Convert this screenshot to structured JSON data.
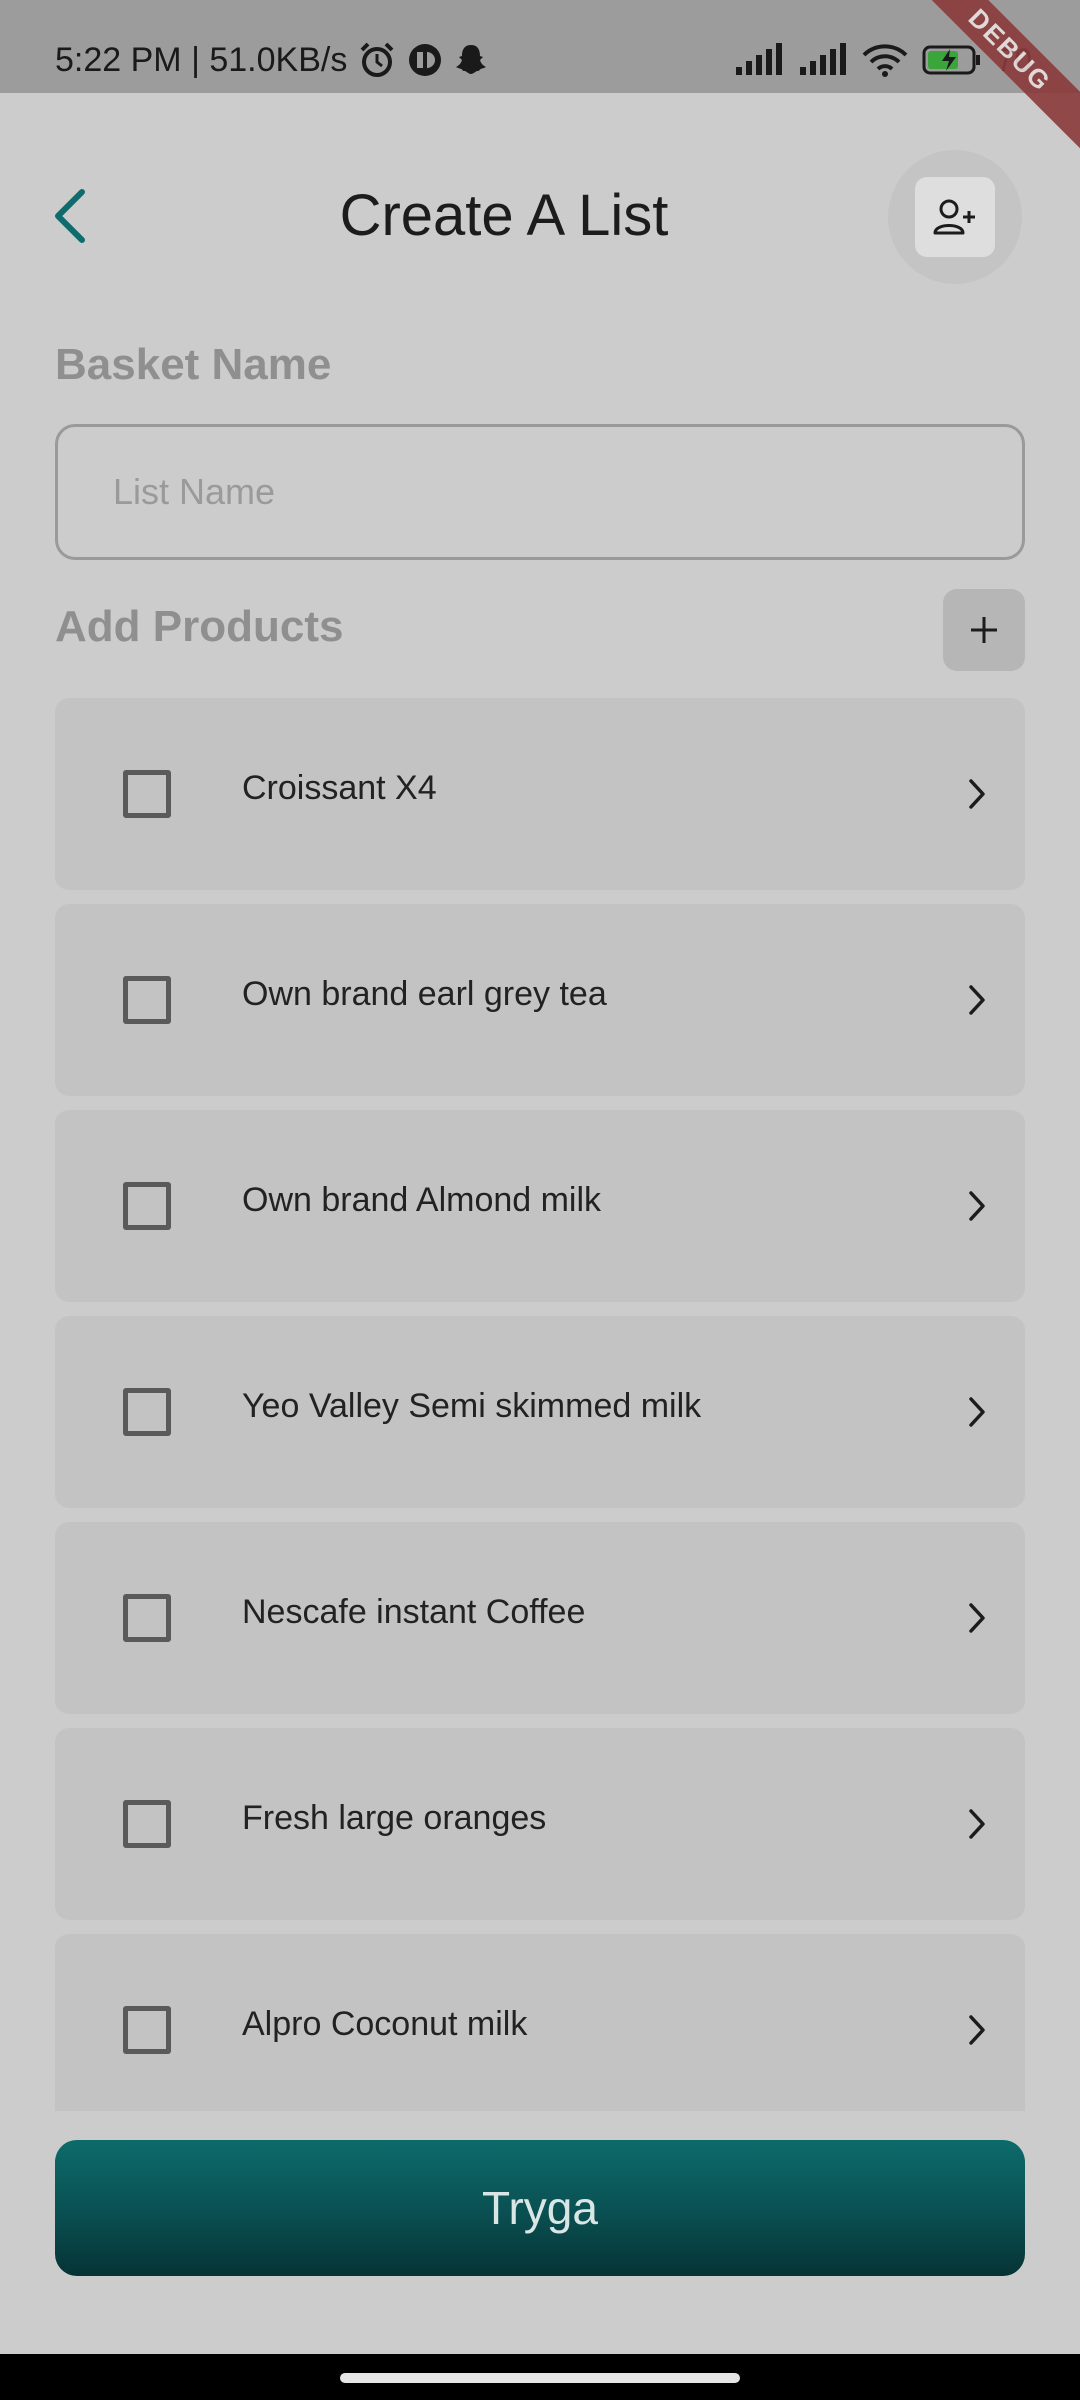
{
  "status_bar": {
    "time_speed": "5:22 PM | 51.0KB/s",
    "battery": "70"
  },
  "debug_banner": "DEBUG",
  "header": {
    "title": "Create A List"
  },
  "basket": {
    "label": "Basket Name",
    "input_placeholder": "List Name",
    "input_value": ""
  },
  "products": {
    "label": "Add Products",
    "items": [
      {
        "name": "Croissant X4",
        "checked": false
      },
      {
        "name": "Own brand earl grey tea",
        "checked": false
      },
      {
        "name": "Own brand Almond milk",
        "checked": false
      },
      {
        "name": "Yeo Valley Semi skimmed milk",
        "checked": false
      },
      {
        "name": "Nescafe instant Coffee",
        "checked": false
      },
      {
        "name": "Fresh large oranges",
        "checked": false
      },
      {
        "name": "Alpro Coconut milk",
        "checked": false
      }
    ]
  },
  "primary_button": {
    "label": "Tryga"
  },
  "colors": {
    "accent": "#0a5a5c",
    "back_icon": "#0e6b6e",
    "background": "#cccccc"
  },
  "icons": {
    "back": "back-arrow-icon",
    "add_user": "add-user-icon",
    "add_product": "plus-icon",
    "item_chevron": "chevron-right-icon"
  }
}
